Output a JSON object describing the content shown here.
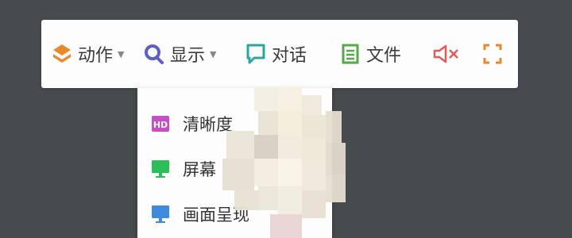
{
  "toolbar": {
    "action_label": "动作",
    "display_label": "显示",
    "dialog_label": "对话",
    "file_label": "文件",
    "caret": "▼"
  },
  "display_menu": {
    "items": [
      {
        "label": "清晰度",
        "icon": "hd-icon"
      },
      {
        "label": "屏幕",
        "icon": "monitor-icon"
      },
      {
        "label": "画面呈现",
        "icon": "monitor-icon"
      }
    ]
  },
  "colors": {
    "background": "#464b4e",
    "action_orange": "#e88a2c",
    "display_purple": "#5b5fc7",
    "dialog_teal": "#2aa6a0",
    "file_green": "#57a84a",
    "mute_red": "#e05a5a",
    "hd_magenta": "#c64fc6",
    "screen_green": "#2bbf5a",
    "render_blue": "#3f8ae0"
  }
}
